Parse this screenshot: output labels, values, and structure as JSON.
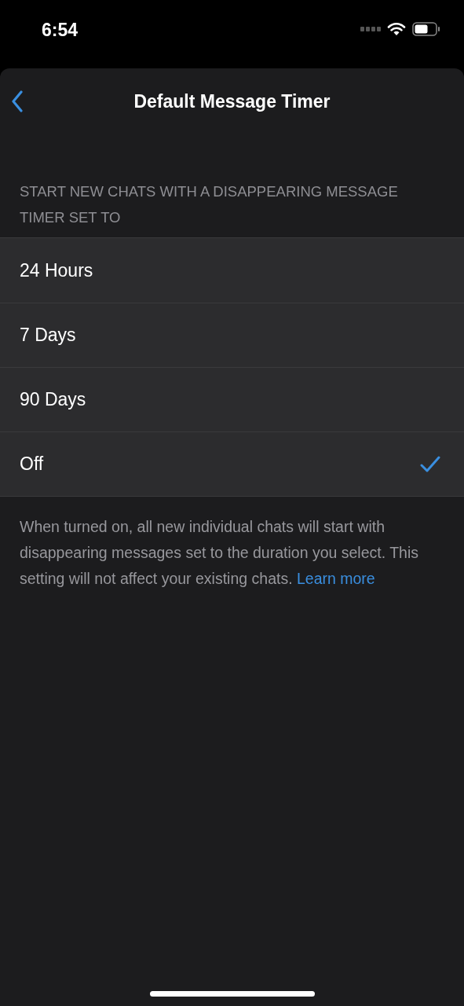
{
  "status_bar": {
    "time": "6:54"
  },
  "nav": {
    "title": "Default Message Timer"
  },
  "section_header": "START NEW CHATS WITH A DISAPPEARING MESSAGE TIMER SET TO",
  "options": [
    {
      "label": "24 Hours",
      "selected": false
    },
    {
      "label": "7 Days",
      "selected": false
    },
    {
      "label": "90 Days",
      "selected": false
    },
    {
      "label": "Off",
      "selected": true
    }
  ],
  "footer": {
    "text": "When turned on, all new individual chats will start with disappearing messages set to the duration you select. This setting will not affect your existing chats.",
    "link": "Learn more"
  }
}
